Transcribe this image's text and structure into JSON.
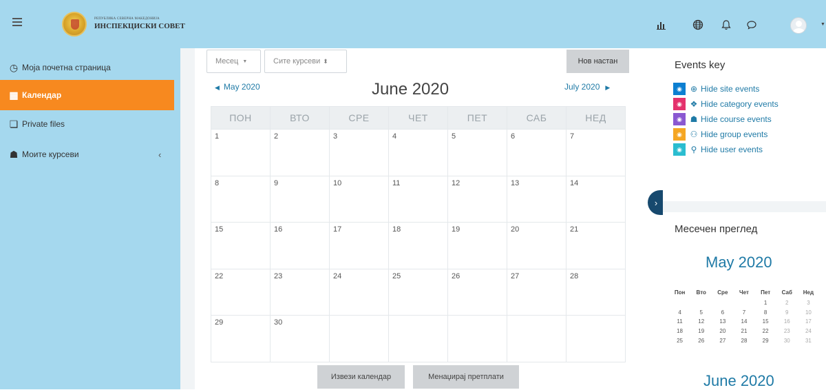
{
  "header": {
    "logo_line1": "РЕПУБЛИКА СЕВЕРНА МАКЕДОНИЈА",
    "logo_line2": "ИНСПЕКЦИСКИ СОВЕТ"
  },
  "sidebar": {
    "items": [
      {
        "label": "Моја почетна страница",
        "icon": "dashboard-icon"
      },
      {
        "label": "Календар",
        "icon": "calendar-icon",
        "active": true
      },
      {
        "label": "Private files",
        "icon": "files-icon"
      },
      {
        "label": "Моите курсеви",
        "icon": "courses-icon"
      }
    ]
  },
  "toolbar": {
    "view_select": "Месец",
    "course_select": "Сите курсеви",
    "new_event": "Нов настан"
  },
  "calendar": {
    "prev_month": "May 2020",
    "title": "June 2020",
    "next_month": "July 2020",
    "weekdays": [
      "ПОН",
      "ВТО",
      "СРЕ",
      "ЧЕТ",
      "ПЕТ",
      "САБ",
      "НЕД"
    ],
    "weeks": [
      [
        "1",
        "2",
        "3",
        "4",
        "5",
        "6",
        "7"
      ],
      [
        "8",
        "9",
        "10",
        "11",
        "12",
        "13",
        "14"
      ],
      [
        "15",
        "16",
        "17",
        "18",
        "19",
        "20",
        "21"
      ],
      [
        "22",
        "23",
        "24",
        "25",
        "26",
        "27",
        "28"
      ],
      [
        "29",
        "30",
        "",
        "",
        "",
        "",
        ""
      ]
    ],
    "export_button": "Извези календар",
    "subscriptions_button": "Менаџирај претплати"
  },
  "events_key": {
    "title": "Events key",
    "items": [
      {
        "label": "Hide site events",
        "color": "#0c7fd1"
      },
      {
        "label": "Hide category events",
        "color": "#e4326d"
      },
      {
        "label": "Hide course events",
        "color": "#8a58d1"
      },
      {
        "label": "Hide group events",
        "color": "#f5a623"
      },
      {
        "label": "Hide user events",
        "color": "#2bbdd0"
      }
    ]
  },
  "monthly_overview": {
    "title": "Месечен преглед",
    "month_title": "May 2020",
    "weekdays": [
      "Пон",
      "Вто",
      "Сре",
      "Чет",
      "Пет",
      "Саб",
      "Нед"
    ],
    "weeks": [
      [
        "",
        "",
        "",
        "",
        "1",
        "2",
        "3"
      ],
      [
        "4",
        "5",
        "6",
        "7",
        "8",
        "9",
        "10"
      ],
      [
        "11",
        "12",
        "13",
        "14",
        "15",
        "16",
        "17"
      ],
      [
        "18",
        "19",
        "20",
        "21",
        "22",
        "23",
        "24"
      ],
      [
        "25",
        "26",
        "27",
        "28",
        "29",
        "30",
        "31"
      ]
    ],
    "next_month_title": "June 2020"
  }
}
